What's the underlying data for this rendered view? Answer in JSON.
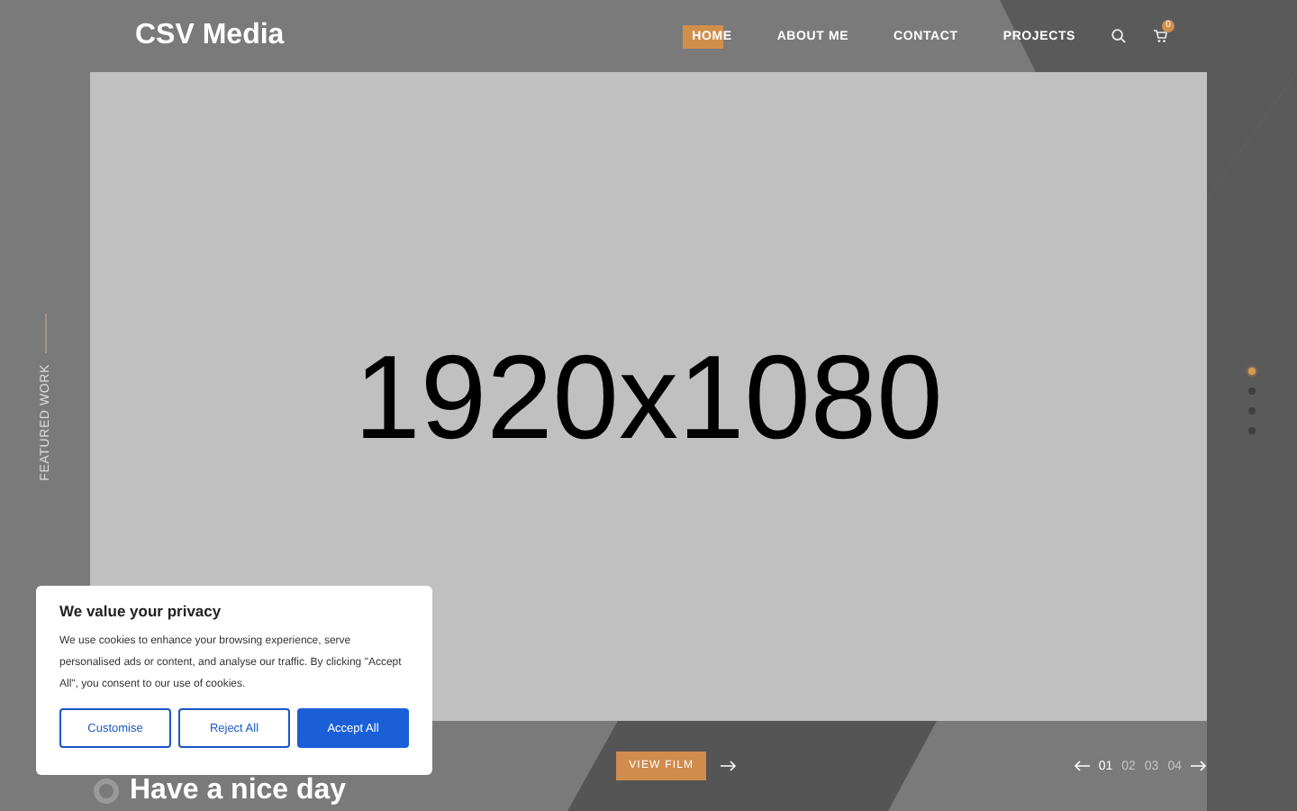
{
  "header": {
    "logo": "CSV Media",
    "nav": [
      {
        "label": "HOME",
        "selected": true
      },
      {
        "label": "ABOUT ME",
        "selected": false
      },
      {
        "label": "CONTACT",
        "selected": false
      },
      {
        "label": "PROJECTS",
        "selected": false
      }
    ],
    "cart_count": "0"
  },
  "side_label": "FEATURED WORK",
  "hero": {
    "placeholder_text": "1920x1080"
  },
  "slide_dots": [
    {
      "selected": true
    },
    {
      "selected": false
    },
    {
      "selected": false
    },
    {
      "selected": false
    }
  ],
  "bottom": {
    "tagline": "Have a nice day",
    "button": "VIEW FILM",
    "pages": [
      {
        "label": "01",
        "selected": true
      },
      {
        "label": "02",
        "selected": false
      },
      {
        "label": "03",
        "selected": false
      },
      {
        "label": "04",
        "selected": false
      }
    ]
  },
  "cookie": {
    "title": "We value your privacy",
    "text": "We use cookies to enhance your browsing experience, serve personalised ads or content, and analyse our traffic. By clicking \"Accept All\", you consent to our use of cookies.",
    "buttons": [
      {
        "label": "Customise",
        "kind": "outline"
      },
      {
        "label": "Reject All",
        "kind": "outline"
      },
      {
        "label": "Accept All",
        "kind": "primary"
      }
    ]
  }
}
